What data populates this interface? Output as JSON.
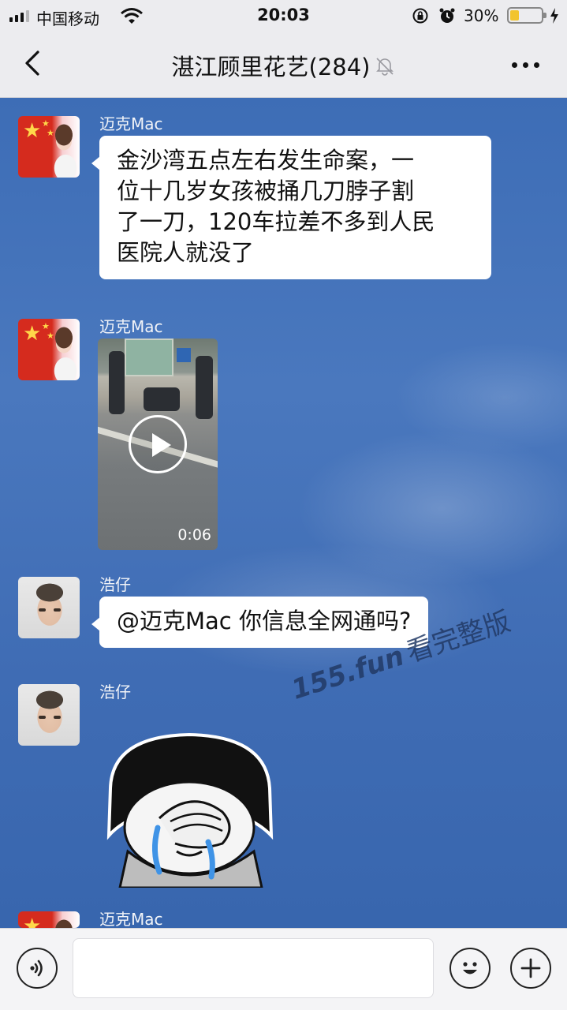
{
  "status_bar": {
    "carrier": "中国移动",
    "time": "20:03",
    "battery_percent": "30%",
    "battery_level": 0.3,
    "icons": [
      "signal-icon",
      "wifi-icon",
      "orientation-lock-icon",
      "alarm-icon",
      "battery-icon",
      "charging-bolt-icon"
    ]
  },
  "header": {
    "title": "湛江顾里花艺(284)",
    "icons": [
      "back-arrow-icon",
      "mute-bell-icon",
      "more-dots-icon"
    ]
  },
  "messages": [
    {
      "sender": "迈克Mac",
      "type": "text",
      "lines": [
        "金沙湾五点左右发生命案，一",
        "位十几岁女孩被捅几刀脖子割",
        "了一刀，120车拉差不多到人民",
        "医院人就没了"
      ]
    },
    {
      "sender": "迈克Mac",
      "type": "video",
      "duration": "0:06"
    },
    {
      "sender": "浩仔",
      "type": "text",
      "lines": [
        "@迈克Mac 你信息全网通吗?"
      ]
    },
    {
      "sender": "浩仔",
      "type": "sticker",
      "sticker": "crying-face-sticker"
    },
    {
      "sender": "迈克Mac",
      "type": "partial"
    }
  ],
  "watermark": {
    "domain": "155.fun",
    "text": "看完整版"
  },
  "input_bar": {
    "value": "",
    "icons": [
      "voice-icon",
      "emoji-icon",
      "plus-icon"
    ]
  },
  "colors": {
    "bar_background": "#ececef",
    "chat_sky": "#3f6bb0",
    "bubble": "#ffffff",
    "battery_fill": "#f2c42e"
  }
}
